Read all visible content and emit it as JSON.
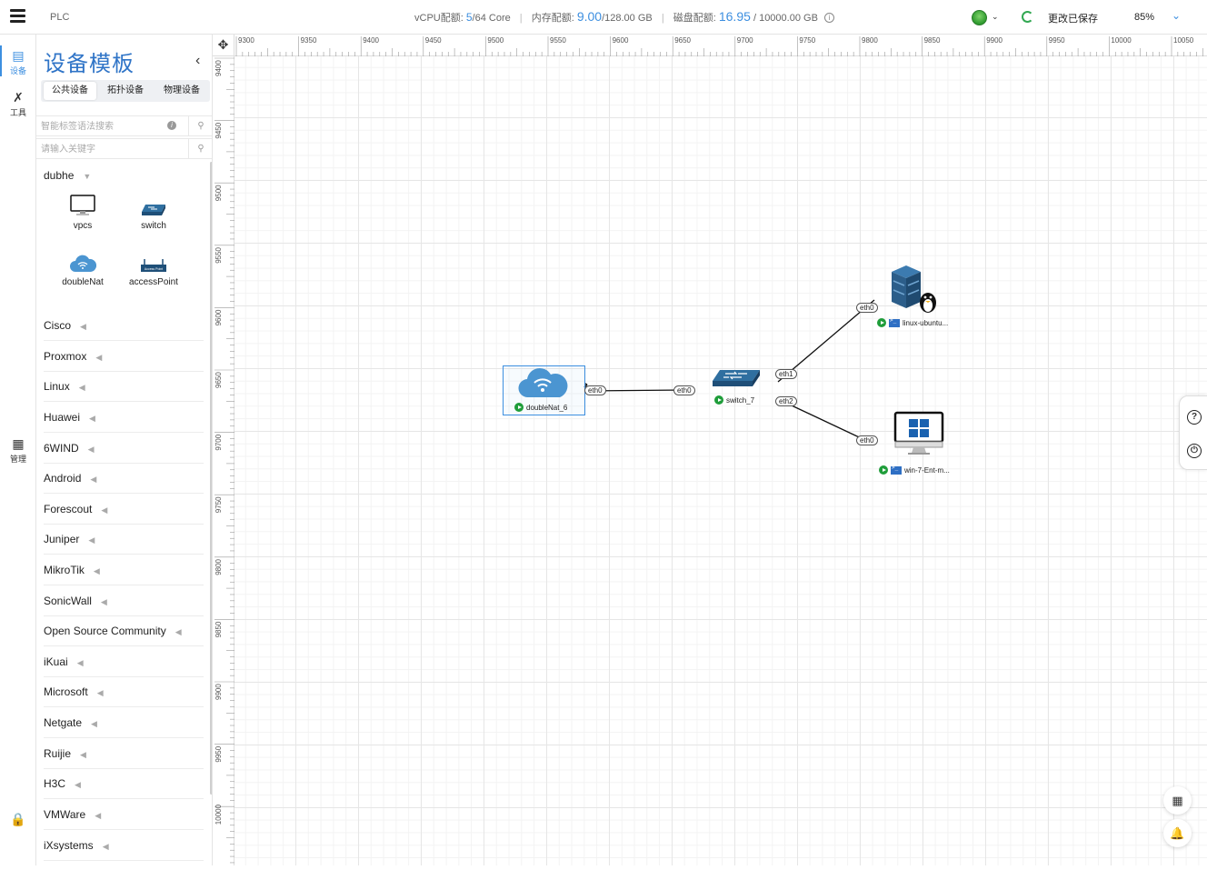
{
  "app": {
    "title": "PLC"
  },
  "quota": {
    "vcpu_label": "vCPU配额:",
    "vcpu_used": "5",
    "vcpu_total": "/64 Core",
    "mem_label": "内存配额:",
    "mem_used": "9.00",
    "mem_total": "/128.00 GB",
    "disk_label": "磁盘配额:",
    "disk_used": "16.95",
    "disk_total": " / 10000.00 GB",
    "info_icon": "info-icon"
  },
  "topbar": {
    "save_status": "更改已保存",
    "zoom": "85%",
    "accent": "#3d8fe0"
  },
  "rail": {
    "items": [
      {
        "label": "设备",
        "icon": "device-icon"
      },
      {
        "label": "工具",
        "icon": "tools-icon"
      },
      {
        "label": "管理",
        "icon": "manage-icon"
      }
    ]
  },
  "panel": {
    "title": "设备模板",
    "tabs": [
      "公共设备",
      "拓扑设备",
      "物理设备"
    ],
    "search_smart_placeholder": "智能标签语法搜索",
    "search_keyword_placeholder": "请输入关键字",
    "group": {
      "name": "dubhe",
      "templates": [
        "vpcs",
        "switch",
        "doubleNat",
        "accessPoint"
      ]
    },
    "accessPoint_badge": "Access Point",
    "vendors": [
      "Cisco",
      "Proxmox",
      "Linux",
      "Huawei",
      "6WIND",
      "Android",
      "Forescout",
      "Juniper",
      "MikroTik",
      "SonicWall",
      "Open Source Community",
      "iKuai",
      "Microsoft",
      "Netgate",
      "Ruijie",
      "H3C",
      "VMWare",
      "iXsystems"
    ]
  },
  "ruler": {
    "x_ticks": [
      "9300",
      "9350",
      "9400",
      "9450",
      "9500",
      "9550",
      "9600",
      "9650",
      "9700",
      "9750",
      "9800",
      "9850",
      "9900",
      "9950",
      "10000",
      "10050"
    ],
    "y_ticks": [
      "9400",
      "9450",
      "9500",
      "9550",
      "9600",
      "9650",
      "9700",
      "9750",
      "9800",
      "9850",
      "9900",
      "9950",
      "10000"
    ]
  },
  "topology": {
    "nodes": {
      "doubleNat": "doubleNat_6",
      "switch": "switch_7",
      "linux": "linux-ubuntu...",
      "win": "win-7-Ent-m..."
    },
    "ports": {
      "dn_eth0": "eth0",
      "sw_eth0": "eth0",
      "sw_eth1": "eth1",
      "sw_eth2": "eth2",
      "linux_eth0": "eth0",
      "win_eth0": "eth0"
    }
  }
}
